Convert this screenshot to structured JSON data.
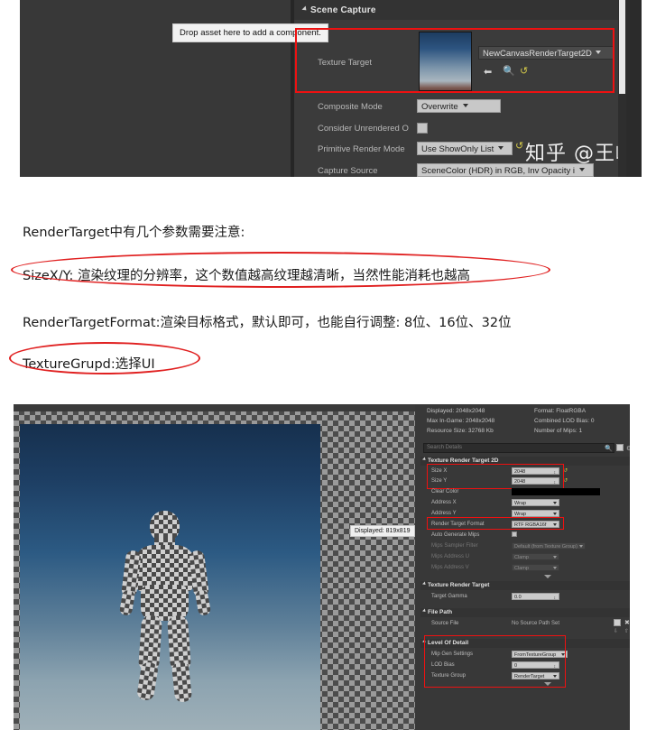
{
  "top_screenshot": {
    "category": "Scene Capture",
    "tooltip": "Drop asset here to add a component.",
    "properties": [
      {
        "label": "Texture Target",
        "value": "NewCanvasRenderTarget2D"
      },
      {
        "label": "Composite Mode",
        "value": "Overwrite"
      },
      {
        "label": "Consider Unrendered O",
        "value": ""
      },
      {
        "label": "Primitive Render Mode",
        "value": "Use ShowOnly List"
      },
      {
        "label": "Capture Source",
        "value": "SceneColor (HDR) in RGB, Inv Opacity i"
      }
    ],
    "watermark": "知乎 @王崎"
  },
  "article": {
    "lines": [
      {
        "text": "RenderTarget中有几个参数需要注意:",
        "circled": false
      },
      {
        "text": "SizeX/Y: 渲染纹理的分辨率，这个数值越高纹理越清晰，当然性能消耗也越高",
        "circled": true
      },
      {
        "text": "RenderTargetFormat:渲染目标格式，默认即可，也能自行调整: 8位、16位、32位",
        "circled": false
      },
      {
        "text": "TextureGrupd:选择UI",
        "circled": true
      }
    ]
  },
  "bottom_screenshot": {
    "viewport": {
      "displayed_tag": "Displayed: 819x819"
    },
    "details_header": [
      {
        "text": "Displayed: 2048x2048"
      },
      {
        "text": "Format: FloatRGBA"
      },
      {
        "text": "Max In-Game: 2048x2048"
      },
      {
        "text": "Combined LOD Bias: 0"
      },
      {
        "text": "Resource Size: 32768 Kb"
      },
      {
        "text": "Number of Mips: 1"
      }
    ],
    "search_placeholder": "Search Details",
    "sections": [
      {
        "title": "Texture Render Target 2D",
        "rows": [
          {
            "label": "Size X",
            "value": "2048",
            "kind": "spin",
            "highlight": true
          },
          {
            "label": "Size Y",
            "value": "2048",
            "kind": "spin",
            "highlight": true
          },
          {
            "label": "Clear Color",
            "value": "",
            "kind": "color",
            "highlight": false
          },
          {
            "label": "Address X",
            "value": "Wrap",
            "kind": "combo",
            "highlight": false
          },
          {
            "label": "Address Y",
            "value": "Wrap",
            "kind": "combo",
            "highlight": false
          },
          {
            "label": "Render Target Format",
            "value": "RTF RGBA16f",
            "kind": "combo",
            "highlight": true
          },
          {
            "label": "Auto Generate Mips",
            "value": "",
            "kind": "check",
            "highlight": false
          },
          {
            "label": "Mips Sampler Filter",
            "value": "Default (from Texture Group)",
            "kind": "combo-dim",
            "highlight": false
          },
          {
            "label": "Mips Address U",
            "value": "Clamp",
            "kind": "combo-dim",
            "highlight": false
          },
          {
            "label": "Mips Address V",
            "value": "Clamp",
            "kind": "combo-dim",
            "highlight": false
          }
        ]
      },
      {
        "title": "Texture Render Target",
        "rows": [
          {
            "label": "Target Gamma",
            "value": "0.0",
            "kind": "spin",
            "highlight": false
          }
        ]
      },
      {
        "title": "File Path",
        "rows": [
          {
            "label": "Source File",
            "value": "No Source Path Set",
            "kind": "text",
            "highlight": false
          }
        ]
      },
      {
        "title": "Level Of Detail",
        "rows": [
          {
            "label": "Mip Gen Settings",
            "value": "FromTextureGroup",
            "kind": "combo",
            "highlight": true
          },
          {
            "label": "LOD Bias",
            "value": "0",
            "kind": "spin",
            "highlight": true
          },
          {
            "label": "Texture Group",
            "value": "RenderTarget",
            "kind": "combo",
            "highlight": true
          }
        ]
      }
    ]
  },
  "colors": {
    "annotation_red": "#ee1111",
    "panel_dark": "#383838",
    "accent_yellow": "#d3c84a"
  }
}
